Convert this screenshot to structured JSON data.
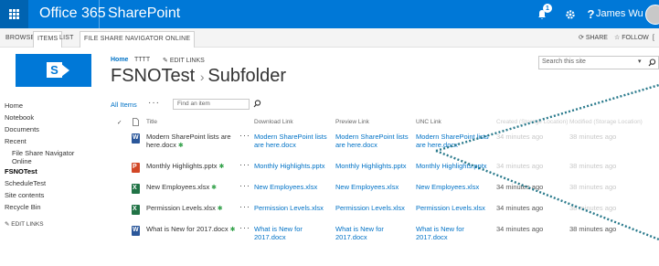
{
  "suitebar": {
    "brand": "Office 365",
    "app": "SharePoint",
    "notification_count": "1",
    "help": "?",
    "user": "James Wu"
  },
  "ribbon": {
    "tabs": [
      "BROWSE",
      "ITEMS",
      "LIST",
      "FILE SHARE NAVIGATOR ONLINE"
    ],
    "actions": [
      "SHARE",
      "FOLLOW"
    ]
  },
  "topnav": {
    "home": "Home",
    "site": "TTTT",
    "edit_links": "EDIT LINKS"
  },
  "title": {
    "parent": "FSNOTest",
    "current": "Subfolder"
  },
  "search_site": {
    "placeholder": "Search this site"
  },
  "leftnav": {
    "items": [
      "Home",
      "Notebook",
      "Documents",
      "Recent",
      "File Share Navigator Online",
      "FSNOTest",
      "ScheduleTest",
      "Site contents",
      "Recycle Bin"
    ],
    "edit_links": "EDIT LINKS"
  },
  "view": {
    "name": "All Items",
    "more": "···",
    "find_placeholder": "Find an item"
  },
  "table": {
    "headers": [
      "Title",
      "Download Link",
      "Preview Link",
      "UNC Link",
      "Created (Storage Location)",
      "Modified (Storage Location)"
    ],
    "rows": [
      {
        "title1": "Modern SharePoint lists are",
        "title2": "here.docx",
        "type": "word",
        "download1": "Modern SharePoint lists",
        "download2": "are here.docx",
        "preview1": "Modern SharePoint lists",
        "preview2": "are here.docx",
        "unc1": "Modern SharePoint lists",
        "unc2": "are here.docx",
        "created": "34 minutes ago",
        "modified": "38 minutes ago"
      },
      {
        "title1": "Monthly Highlights.pptx",
        "title2": "",
        "type": "ppt",
        "download1": "Monthly Highlights.pptx",
        "download2": "",
        "preview1": "Monthly Highlights.pptx",
        "preview2": "",
        "unc1": "Monthly Highlights.pptx",
        "unc2": "",
        "created": "34 minutes ago",
        "modified": "38 minutes ago"
      },
      {
        "title1": "New Employees.xlsx",
        "title2": "",
        "type": "excel",
        "download1": "New Employees.xlsx",
        "download2": "",
        "preview1": "New Employees.xlsx",
        "preview2": "",
        "unc1": "New Employees.xlsx",
        "unc2": "",
        "created": "34 minutes ago",
        "modified": "38 minutes ago"
      },
      {
        "title1": "Permission Levels.xlsx",
        "title2": "",
        "type": "excel",
        "download1": "Permission Levels.xlsx",
        "download2": "",
        "preview1": "Permission Levels.xlsx",
        "preview2": "",
        "unc1": "Permission Levels.xlsx",
        "unc2": "",
        "created": "34 minutes ago",
        "modified": "38 minutes ago"
      },
      {
        "title1": "What is New for 2017.docx",
        "title2": "",
        "type": "word",
        "download1": "What is New for",
        "download2": "2017.docx",
        "preview1": "What is New for",
        "preview2": "2017.docx",
        "unc1": "What is New for",
        "unc2": "2017.docx",
        "created": "34 minutes ago",
        "modified": "38 minutes ago"
      }
    ]
  },
  "colors": {
    "suitebar": "#0078d7",
    "link": "#0072c6",
    "word": "#2b579a",
    "excel": "#217346",
    "ppt": "#d24726",
    "callout": "#2a7a8c"
  }
}
